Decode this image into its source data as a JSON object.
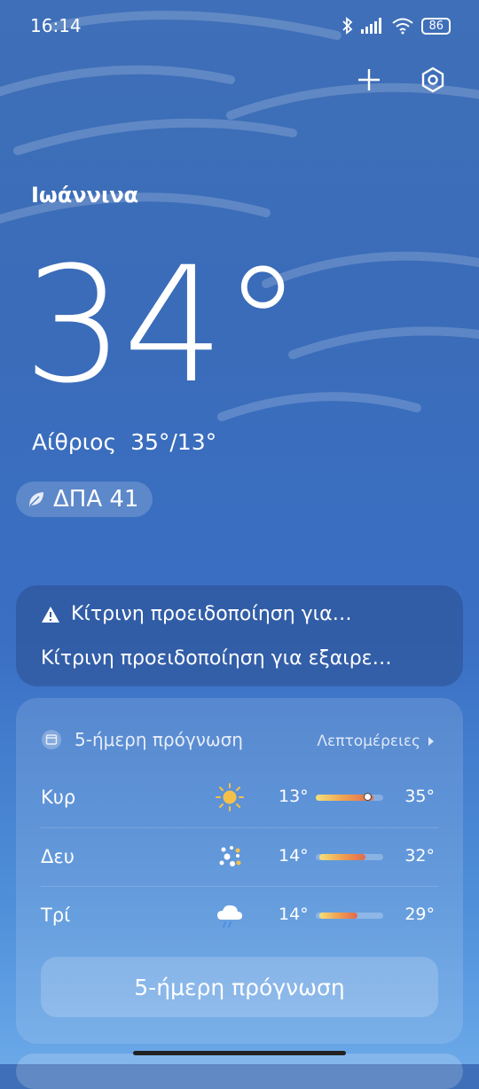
{
  "status": {
    "time": "16:14",
    "battery": "86"
  },
  "location": {
    "city": "Ιωάννινα"
  },
  "current": {
    "temp": "34°",
    "condition": "Αίθριος",
    "range": "35°/13°",
    "aqi_label": "ΔΠΑ 41"
  },
  "alert": {
    "title": "Κίτρινη προειδοποίηση για…",
    "subtitle": "Κίτρινη προειδοποίηση για εξαιρε…"
  },
  "forecast": {
    "title": "5-ήμερη πρόγνωση",
    "details_label": "Λεπτομέρειες",
    "button_label": "5-ήμερη πρόγνωση",
    "days": [
      {
        "day": "Κυρ",
        "icon": "sunny-icon",
        "low": "13°",
        "high": "35°",
        "low_frac": 0.0,
        "high_frac": 0.86,
        "current_frac": 0.77
      },
      {
        "day": "Δευ",
        "icon": "hail-icon",
        "low": "14°",
        "high": "32°",
        "low_frac": 0.05,
        "high_frac": 0.74
      },
      {
        "day": "Τρί",
        "icon": "rain-cloud-icon",
        "low": "14°",
        "high": "29°",
        "low_frac": 0.05,
        "high_frac": 0.62
      }
    ]
  },
  "colors": {
    "bg_top": "#3f6fb8",
    "bg_bottom": "#6aa8e8",
    "accent_warm": "#f0a050"
  }
}
